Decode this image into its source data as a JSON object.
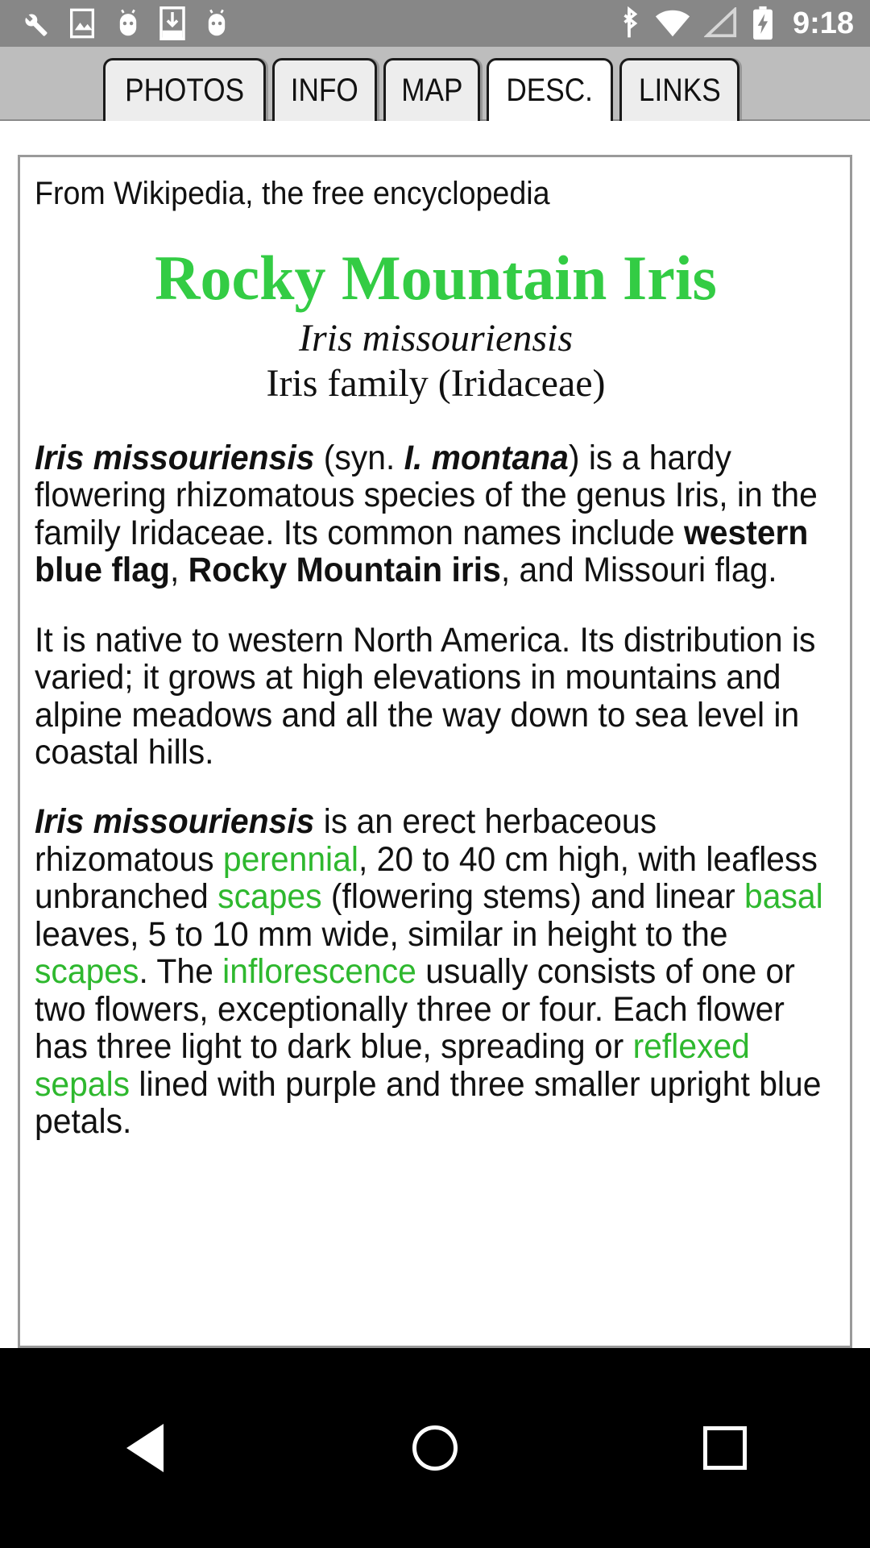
{
  "status_bar": {
    "clock": "9:18",
    "left_icons": [
      "wrench-icon",
      "image-icon",
      "android-icon",
      "download-icon",
      "android-icon"
    ],
    "right_icons": [
      "bluetooth-icon",
      "wifi-icon",
      "signal-icon",
      "battery-charging-icon"
    ],
    "background_color": "#878787"
  },
  "tabs": [
    {
      "label": "PHOTOS",
      "active": false
    },
    {
      "label": "INFO",
      "active": false
    },
    {
      "label": "MAP",
      "active": false
    },
    {
      "label": "DESC.",
      "active": true
    },
    {
      "label": "LINKS",
      "active": false
    }
  ],
  "article": {
    "source_line": "From Wikipedia, the free encyclopedia",
    "title": "Rocky Mountain Iris",
    "title_color": "#33cc44",
    "binomial": "Iris missouriensis",
    "family": "Iris family (Iridaceae)",
    "link_color": "#2eb82e",
    "paragraph1": {
      "species": "Iris missouriensis",
      "syn_open": " (syn. ",
      "synonym": "I. montana",
      "mid": ") is a hardy flowering rhizomatous species of the genus Iris, in the family Iridaceae. Its common names include ",
      "common1": "western blue flag",
      "sep1": ", ",
      "common2": "Rocky Mountain iris",
      "tail": ", and Missouri flag."
    },
    "paragraph2": "It is native to western North America. Its distribution is varied; it grows at high elevations in mountains and alpine meadows and all the way down to sea level in coastal hills.",
    "paragraph3": {
      "species": "Iris missouriensis",
      "t1": " is an erect herbaceous rhizomatous ",
      "link1": "perennial",
      "t2": ", 20 to 40 cm high, with leafless unbranched ",
      "link2": "scapes",
      "t3": " (flowering stems) and linear ",
      "link3": "basal",
      "t4": " leaves, 5 to 10 mm wide, similar in height to the ",
      "link4": "scapes",
      "t5": ". The ",
      "link5": "inflorescence",
      "t6": " usually consists of one or two flowers, exceptionally three or four. Each flower has three light to dark blue, spreading or ",
      "link6": "reflexed sepals",
      "t7": " lined with purple and three smaller upright blue petals."
    }
  },
  "nav_bar": {
    "buttons": [
      "back-button",
      "home-button",
      "recents-button"
    ],
    "background_color": "#000000"
  }
}
